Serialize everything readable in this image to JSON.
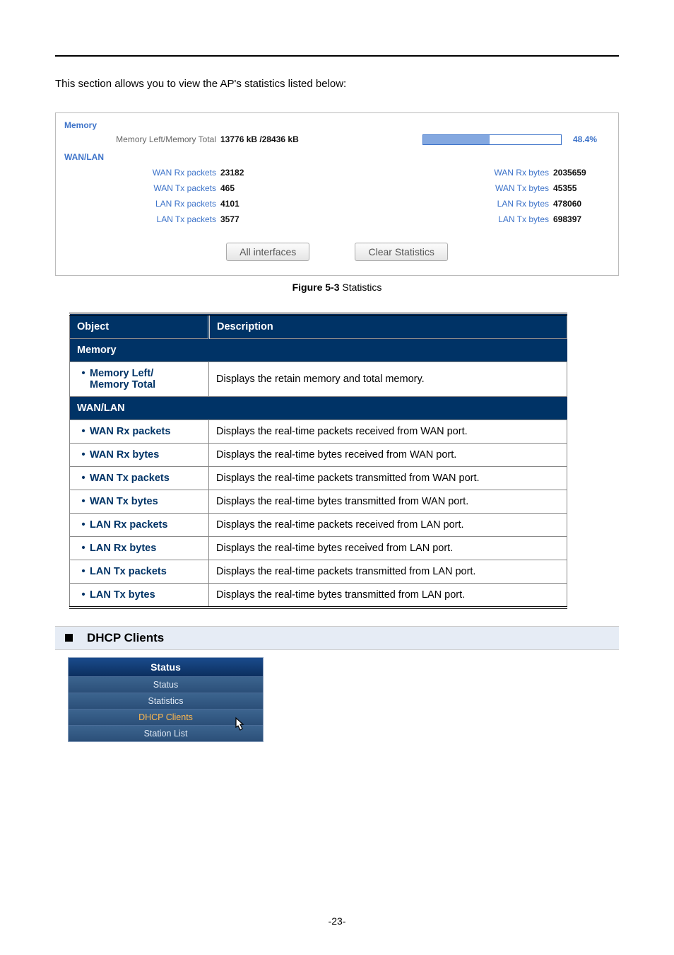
{
  "intro": "This section allows you to view the AP's statistics listed below:",
  "stats": {
    "memory_title": "Memory",
    "memory_label": "Memory Left/Memory Total",
    "memory_value": "13776 kB /28436 kB",
    "memory_percent_display": "48.4%",
    "memory_percent_fill": 48.4,
    "wanlan_title": "WAN/LAN",
    "left": [
      {
        "label": "WAN Rx packets",
        "value": "23182"
      },
      {
        "label": "WAN Tx packets",
        "value": "465"
      },
      {
        "label": "LAN Rx packets",
        "value": "4101"
      },
      {
        "label": "LAN Tx packets",
        "value": "3577"
      }
    ],
    "right": [
      {
        "label": "WAN Rx bytes",
        "value": "2035659"
      },
      {
        "label": "WAN Tx bytes",
        "value": "45355"
      },
      {
        "label": "LAN Rx bytes",
        "value": "478060"
      },
      {
        "label": "LAN Tx bytes",
        "value": "698397"
      }
    ],
    "btn_all": "All interfaces",
    "btn_clear": "Clear Statistics"
  },
  "figure": {
    "num": "Figure 5-3",
    "title": " Statistics"
  },
  "table": {
    "h_obj": "Object",
    "h_desc": "Description",
    "sect_memory": "Memory",
    "row_mem_obj": "Memory Left/ Memory Total",
    "row_mem_desc": "Displays the retain memory and total memory.",
    "sect_wanlan": "WAN/LAN",
    "rows": [
      {
        "obj": "WAN Rx packets",
        "desc": "Displays the real-time packets received from WAN port."
      },
      {
        "obj": "WAN Rx bytes",
        "desc": "Displays the real-time bytes received from WAN port."
      },
      {
        "obj": "WAN Tx packets",
        "desc": "Displays the real-time packets transmitted from WAN port."
      },
      {
        "obj": "WAN Tx bytes",
        "desc": "Displays the real-time bytes transmitted from WAN port."
      },
      {
        "obj": "LAN Rx packets",
        "desc": "Displays the real-time packets received from LAN port."
      },
      {
        "obj": "LAN Rx bytes",
        "desc": "Displays the real-time bytes received from LAN port."
      },
      {
        "obj": "LAN Tx packets",
        "desc": "Displays the real-time packets transmitted from LAN port."
      },
      {
        "obj": "LAN Tx bytes",
        "desc": "Displays the real-time bytes transmitted from LAN port."
      }
    ]
  },
  "dhcp_title": "DHCP Clients",
  "menu": {
    "header": "Status",
    "items": [
      "Status",
      "Statistics",
      "DHCP Clients",
      "Station List"
    ],
    "selected_index": 2
  },
  "page_number": "-23-"
}
